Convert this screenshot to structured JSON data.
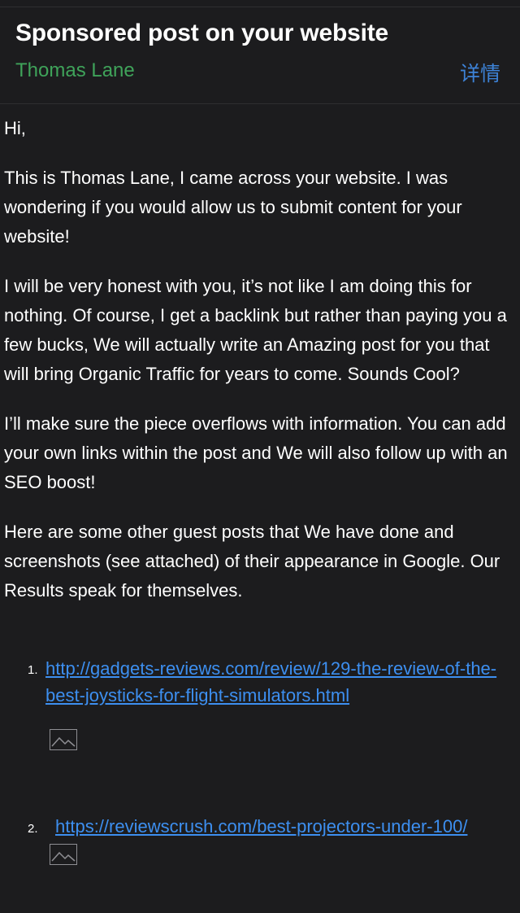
{
  "email": {
    "subject": "Sponsored post on your website",
    "sender": "Thomas Lane",
    "details_label": "详情"
  },
  "body": {
    "paragraphs": [
      "Hi,",
      "This is Thomas Lane, I came across your website. I was wondering if you would allow us to submit content for your website!",
      "I will be very honest with you, it’s not like I am doing this for nothing. Of course, I get a backlink but rather than paying you a few bucks, We will actually write an Amazing post for you that will bring Organic Traffic for years to come. Sounds Cool?",
      "I’ll make sure the piece overflows with information. You can add your own links within the post and We will also follow up with an SEO boost!",
      "Here are some other guest posts that We have done and screenshots (see attached) of their appearance in Google. Our Results speak for themselves."
    ],
    "links": [
      {
        "number": "1.",
        "url": "http://gadgets-reviews.com/review/129-the-review-of-the-best-joysticks-for-flight-simulators.html",
        "image_icon": "broken-image-icon"
      },
      {
        "number": "2.",
        "url": "https://reviewscrush.com/best-projectors-under-100/",
        "image_icon": "broken-image-icon"
      }
    ]
  },
  "colors": {
    "background": "#1c1c1e",
    "sender_green": "#3fa35a",
    "link_blue": "#3d8ff0",
    "details_blue": "#3d82d6"
  }
}
